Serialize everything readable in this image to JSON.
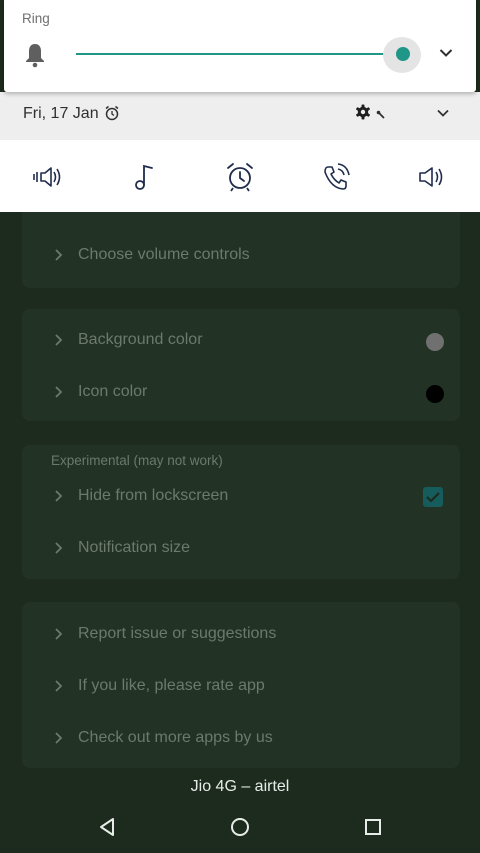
{
  "volume_panel": {
    "stream_label": "Ring",
    "level_fraction": 0.99,
    "accent_color": "#1f9688"
  },
  "status_row": {
    "date": "Fri, 17 Jan"
  },
  "stream_buttons": [
    "speaker-vibrate-icon",
    "music-note-icon",
    "alarm-clock-icon",
    "phone-ringing-icon",
    "volume-speaker-icon"
  ],
  "settings": {
    "choose_volume_controls": "Choose volume controls",
    "background_color": "Background color",
    "background_color_value": "#707070",
    "icon_color": "Icon color",
    "icon_color_value": "#000000",
    "experimental_caption": "Experimental (may not work)",
    "hide_from_lockscreen": "Hide from lockscreen",
    "hide_from_lockscreen_checked": true,
    "notification_size": "Notification size",
    "report_issue": "Report issue or suggestions",
    "rate_app": "If you like, please rate app",
    "more_apps": "Check out more apps by us"
  },
  "carrier": "Jio 4G – airtel"
}
